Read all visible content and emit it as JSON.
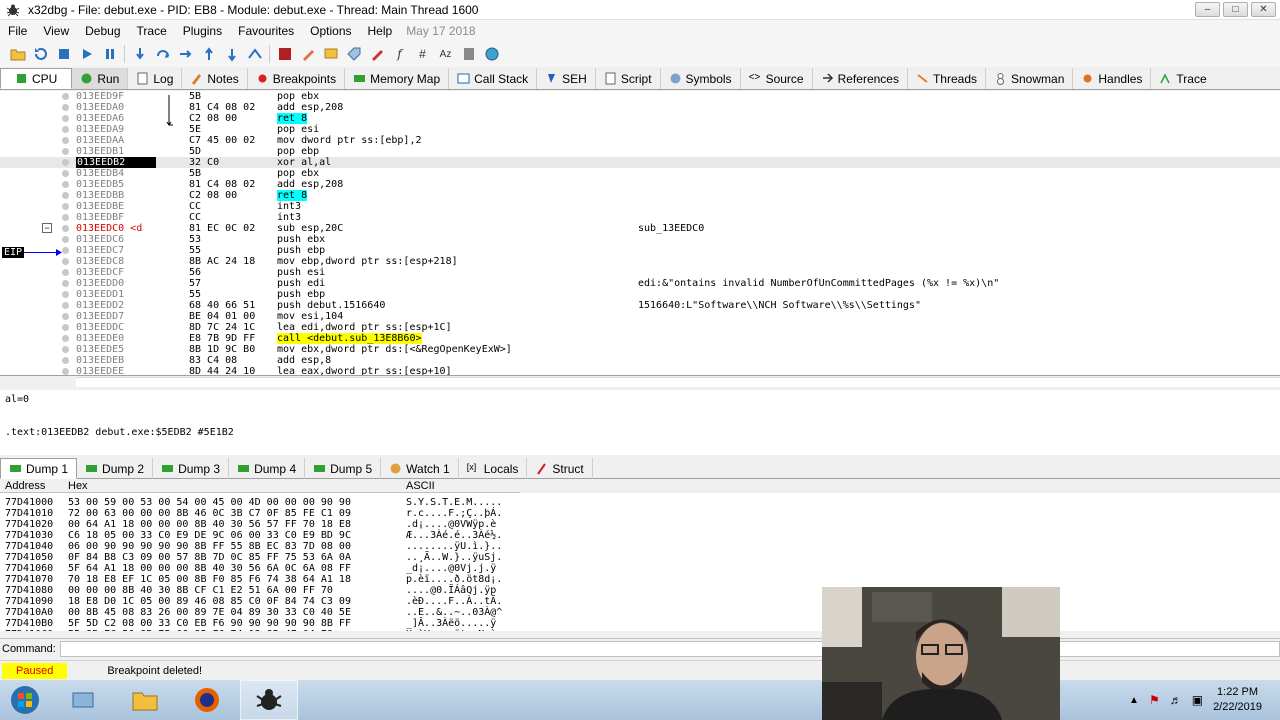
{
  "window": {
    "title": "x32dbg - File: debut.exe - PID: EB8 - Module: debut.exe - Thread: Main Thread 1600"
  },
  "menu": {
    "items": [
      "File",
      "View",
      "Debug",
      "Trace",
      "Plugins",
      "Favourites",
      "Options",
      "Help"
    ],
    "date": "May 17 2018"
  },
  "tabs": [
    {
      "label": "CPU",
      "icon": "cpu-icon"
    },
    {
      "label": "Run",
      "icon": "run-icon"
    },
    {
      "label": "Log",
      "icon": "log-icon"
    },
    {
      "label": "Notes",
      "icon": "notes-icon"
    },
    {
      "label": "Breakpoints",
      "icon": "breakpoint-icon"
    },
    {
      "label": "Memory Map",
      "icon": "memory-map-icon"
    },
    {
      "label": "Call Stack",
      "icon": "call-stack-icon"
    },
    {
      "label": "SEH",
      "icon": "seh-icon"
    },
    {
      "label": "Script",
      "icon": "script-icon"
    },
    {
      "label": "Symbols",
      "icon": "symbols-icon"
    },
    {
      "label": "Source",
      "icon": "source-icon"
    },
    {
      "label": "References",
      "icon": "references-icon"
    },
    {
      "label": "Threads",
      "icon": "threads-icon"
    },
    {
      "label": "Snowman",
      "icon": "snowman-icon"
    },
    {
      "label": "Handles",
      "icon": "handles-icon"
    },
    {
      "label": "Trace",
      "icon": "trace-icon"
    }
  ],
  "disasm": {
    "eip_label": "EIP",
    "rows": [
      {
        "addr": "013EED9F",
        "bytes": "5B",
        "instr": "pop ebx",
        "cmt": ""
      },
      {
        "addr": "013EEDA0",
        "bytes": "81 C4 08 02",
        "instr": "add esp,208",
        "cmt": ""
      },
      {
        "addr": "013EEDA6",
        "bytes": "C2 08 00",
        "instr": "ret 8",
        "cmt": ""
      },
      {
        "addr": "013EEDA9",
        "bytes": "5E",
        "instr": "pop esi",
        "cmt": ""
      },
      {
        "addr": "013EEDAA",
        "bytes": "C7 45 00 02",
        "instr": "mov dword ptr ss:[ebp],2",
        "cmt": ""
      },
      {
        "addr": "013EEDB1",
        "bytes": "5D",
        "instr": "pop ebp",
        "cmt": ""
      },
      {
        "addr": "013EEDB2",
        "bytes": "32 C0",
        "instr": "xor al,al",
        "cmt": ""
      },
      {
        "addr": "013EEDB4",
        "bytes": "5B",
        "instr": "pop ebx",
        "cmt": ""
      },
      {
        "addr": "013EEDB5",
        "bytes": "81 C4 08 02",
        "instr": "add esp,208",
        "cmt": ""
      },
      {
        "addr": "013EEDBB",
        "bytes": "C2 08 00",
        "instr": "ret 8",
        "cmt": ""
      },
      {
        "addr": "013EEDBE",
        "bytes": "CC",
        "instr": "int3",
        "cmt": ""
      },
      {
        "addr": "013EEDBF",
        "bytes": "CC",
        "instr": "int3",
        "cmt": ""
      },
      {
        "addr": "013EEDC0 <d",
        "bytes": "81 EC 0C 02",
        "instr": "sub esp,20C",
        "cmt": "sub_13EEDC0"
      },
      {
        "addr": "013EEDC6",
        "bytes": "53",
        "instr": "push ebx",
        "cmt": ""
      },
      {
        "addr": "013EEDC7",
        "bytes": "55",
        "instr": "push ebp",
        "cmt": ""
      },
      {
        "addr": "013EEDC8",
        "bytes": "8B AC 24 18",
        "instr": "mov ebp,dword ptr ss:[esp+218]",
        "cmt": ""
      },
      {
        "addr": "013EEDCF",
        "bytes": "56",
        "instr": "push esi",
        "cmt": ""
      },
      {
        "addr": "013EEDD0",
        "bytes": "57",
        "instr": "push edi",
        "cmt": "edi:&\"ontains invalid NumberOfUnCommittedPages (%x != %x)\\n\""
      },
      {
        "addr": "013EEDD1",
        "bytes": "55",
        "instr": "push ebp",
        "cmt": ""
      },
      {
        "addr": "013EEDD2",
        "bytes": "68 40 66 51",
        "instr": "push debut.1516640",
        "cmt": "1516640:L\"Software\\\\NCH Software\\\\%s\\\\Settings\""
      },
      {
        "addr": "013EEDD7",
        "bytes": "BE 04 01 00",
        "instr": "mov esi,104",
        "cmt": ""
      },
      {
        "addr": "013EEDDC",
        "bytes": "8D 7C 24 1C",
        "instr": "lea edi,dword ptr ss:[esp+1C]",
        "cmt": ""
      },
      {
        "addr": "013EEDE0",
        "bytes": "E8 7B 9D FF",
        "instr": "call <debut.sub_13E8B60>",
        "cmt": ""
      },
      {
        "addr": "013EEDE5",
        "bytes": "8B 1D 9C B0",
        "instr": "mov ebx,dword ptr ds:[<&RegOpenKeyExW>]",
        "cmt": ""
      },
      {
        "addr": "013EEDEB",
        "bytes": "83 C4 08",
        "instr": "add esp,8",
        "cmt": ""
      },
      {
        "addr": "013EEDEE",
        "bytes": "8D 44 24 10",
        "instr": "lea eax,dword ptr ss:[esp+10]",
        "cmt": ""
      }
    ]
  },
  "info": {
    "line1": "al=0",
    "line2": ".text:013EEDB2 debut.exe:$5EDB2 #5E1B2"
  },
  "dump_tabs": [
    "Dump 1",
    "Dump 2",
    "Dump 3",
    "Dump 4",
    "Dump 5",
    "Watch 1",
    "Locals",
    "Struct"
  ],
  "dump": {
    "header_address": "Address",
    "header_hex": "Hex",
    "header_ascii": "ASCII",
    "rows": [
      {
        "a": "77D41000",
        "h": "53 00 59 00 53 00 54 00 45 00 4D 00 00 00 90 90",
        "s": "S.Y.S.T.E.M....."
      },
      {
        "a": "77D41010",
        "h": "72 00 63 00 00 00 8B 46 0C 3B C7 0F 85 FE C1 09",
        "s": "r.c....F.;Ç..þÁ."
      },
      {
        "a": "77D41020",
        "h": "00 64 A1 18 00 00 00 8B 40 30 56 57 FF 70 18 E8",
        "s": ".d¡....@0VWÿp.è"
      },
      {
        "a": "77D41030",
        "h": "C6 18 05 00 33 C0 E9 DE 9C 06 00 33 C0 E9 BD 9C",
        "s": "Æ...3Àé.é..3Àé½."
      },
      {
        "a": "77D41040",
        "h": "06 00 90 90 90 90 90 8B FF 55 8B EC 83 7D 08 00",
        "s": "........ÿU.ì.}.."
      },
      {
        "a": "77D41050",
        "h": "0F 84 B8 C3 09 00 57 8B 7D 0C 85 FF 75 53 6A 0A",
        "s": "..¸Ã..W.}..ÿuSj."
      },
      {
        "a": "77D41060",
        "h": "5F 64 A1 18 00 00 00 8B 40 30 56 6A 0C 6A 08 FF",
        "s": "_d¡....@0Vj.j.ÿ"
      },
      {
        "a": "77D41070",
        "h": "70 18 E8 EF 1C 05 00 8B F0 85 F6 74 38 64 A1 18",
        "s": "p.èï....ð.öt8d¡."
      },
      {
        "a": "77D41080",
        "h": "00 00 00 8B 40 30 8B CF C1 E2 51 6A 00 FF 70",
        "s": "....@0.ÏÁâQj.ÿp"
      },
      {
        "a": "77D41090",
        "h": "18 E8 D0 1C 05 00 89 46 08 85 C0 0F 84 74 C3 09",
        "s": ".èÐ....F..À..tÃ."
      },
      {
        "a": "77D410A0",
        "h": "00 8B 45 08 83 26 00 89 7E 04 89 30 33 C0 40 5E",
        "s": "..E..&..~..03À@^"
      },
      {
        "a": "77D410B0",
        "h": "5F 5D C2 08 00 33 C0 EB F6 90 90 90 90 90 8B FF",
        "s": "_]Â..3Àëö.....ÿ"
      },
      {
        "a": "77D410C0",
        "h": "55 8B EC 56 8B 75 08 85 F6 74 13 8B 4E 04 E8",
        "s": "U.ìV.u..öt..N.è"
      }
    ]
  },
  "command": {
    "label": "Command:",
    "value": ""
  },
  "status": {
    "badge": "Paused",
    "message": "Breakpoint deleted!"
  },
  "clock": {
    "time": "1:22 PM",
    "date": "2/22/2019"
  }
}
